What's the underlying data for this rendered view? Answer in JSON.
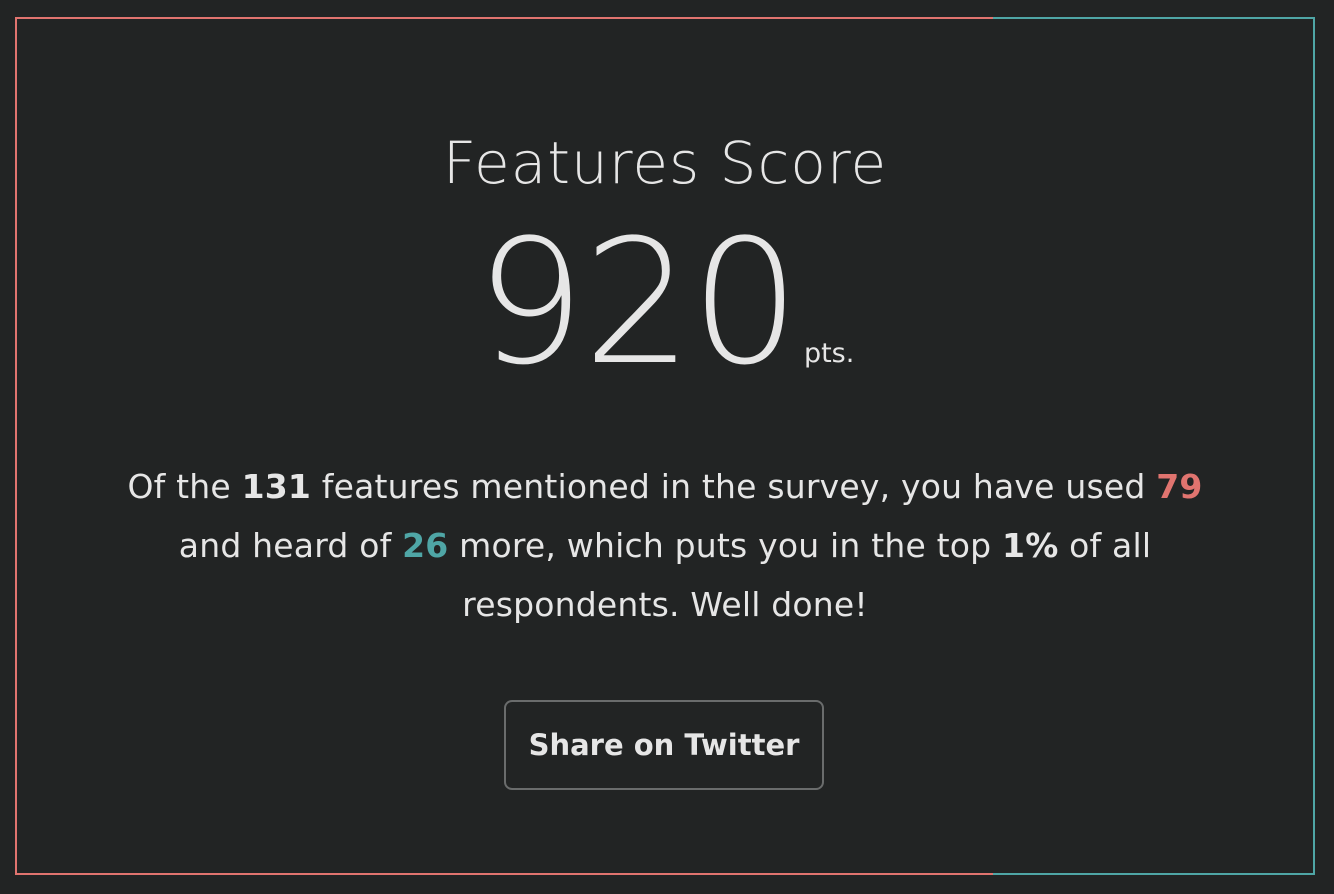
{
  "title": "Features Score",
  "score": {
    "value": "920",
    "unit": "pts."
  },
  "summary": {
    "part1": "Of the ",
    "total_features": "131",
    "part2": " features mentioned in the survey, you have used ",
    "used": "79",
    "part3": " and heard of ",
    "heard_of": "26",
    "part4": " more, which puts you in the top ",
    "percentile": "1%",
    "part5": " of all respondents. Well done!"
  },
  "share_button": {
    "label": "Share on Twitter"
  },
  "colors": {
    "background": "#222424",
    "accent_red": "#e0746f",
    "accent_teal": "#4fa6a6",
    "text": "#e6e6e6"
  }
}
